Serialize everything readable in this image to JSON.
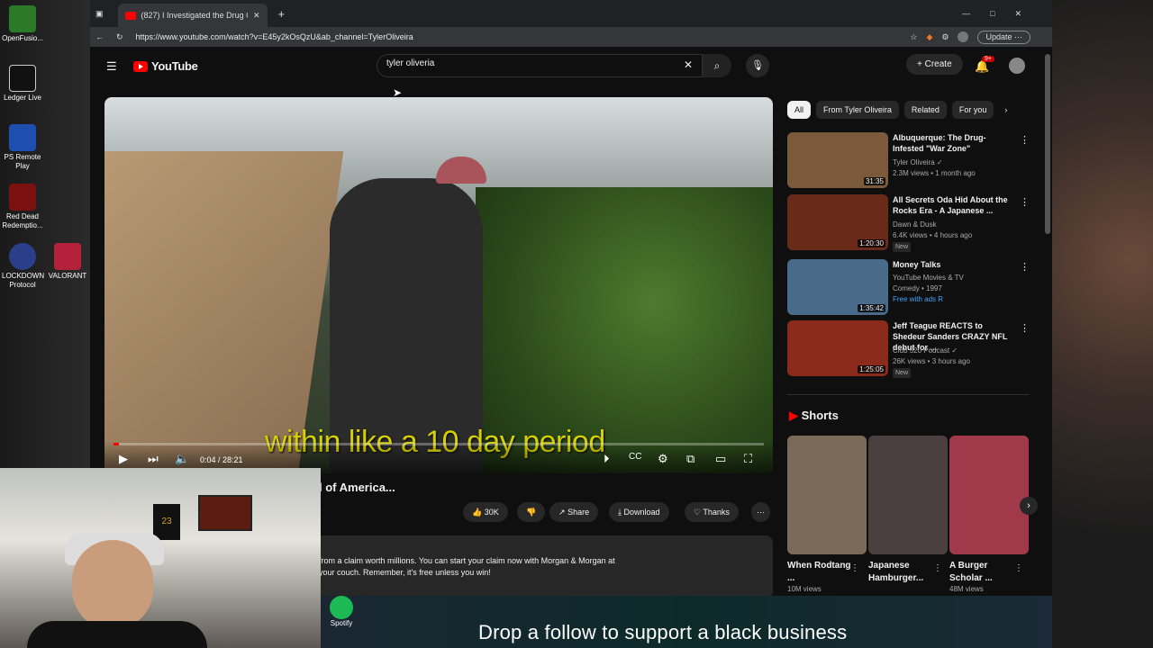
{
  "desktop": {
    "icons": [
      {
        "label": "OpenFusio...",
        "color": "#2a7a2a"
      },
      {
        "label": "Ledger Live",
        "color": "#111"
      },
      {
        "label": "PS Remote Play",
        "color": "#1d4fb0"
      },
      {
        "label": "Red Dead Redemptio...",
        "color": "#7a1010"
      },
      {
        "label": "LOCKDOWN Protocol",
        "color": "#2a3e8a"
      },
      {
        "label": "VALORANT",
        "color": "#b3223a"
      }
    ]
  },
  "browser": {
    "tab_title": "(827) I Investigated the Drug Ov...",
    "url": "https://www.youtube.com/watch?v=E45y2kOsQzU&ab_channel=TylerOliveira",
    "update_label": "Update"
  },
  "youtube": {
    "logo": "YouTube",
    "search_value": "tyler oliveria",
    "create_label": "Create",
    "notif_count": "9+",
    "video": {
      "caption": "within like a 10 day period",
      "time": "0:04 / 28:21",
      "progress": 0.002,
      "title": "l of America...",
      "likes": "30K",
      "share": "Share",
      "download": "Download",
      "thanks": "Thanks"
    },
    "description": {
      "line1": "from a claim worth millions. You can start your claim now with Morgan & Morgan at",
      "line2": "your couch. Remember, it's free unless you win!"
    },
    "chips": [
      "All",
      "From Tyler Oliveira",
      "Related",
      "For you"
    ],
    "recs": [
      {
        "title": "Albuquerque: The Drug-Infested \"War Zone\"",
        "channel": "Tyler Oliveira ✓",
        "meta": "2.3M views • 1 month ago",
        "duration": "31:35",
        "badge": "",
        "thumb": "#7a5a3a"
      },
      {
        "title": "All Secrets Oda Hid About the Rocks Era - A Japanese ...",
        "channel": "Dawn & Dusk",
        "meta": "6.4K views • 4 hours ago",
        "duration": "1:20:30",
        "badge": "New",
        "thumb": "#6a2a1a"
      },
      {
        "title": "Money Talks",
        "channel": "YouTube Movies & TV",
        "meta": "Comedy • 1997",
        "duration": "1:35:42",
        "badge": "Free with ads  R",
        "thumb": "#4a6a8a"
      },
      {
        "title": "Jeff Teague REACTS to Shedeur Sanders CRAZY NFL debut for ...",
        "channel": "Club 520 Podcast ✓",
        "meta": "26K views • 3 hours ago",
        "duration": "1:25:05",
        "badge": "New",
        "thumb": "#8a2a1a"
      }
    ],
    "shorts_heading": "Shorts",
    "shorts": [
      {
        "title": "When Rodtang ...",
        "views": "10M views",
        "color": "#7a6a5a"
      },
      {
        "title": "Japanese Hamburger...",
        "views": "",
        "color": "#4a4040"
      },
      {
        "title": "A Burger Scholar ...",
        "views": "48M views",
        "color": "#a03a4a"
      }
    ]
  },
  "stream_overlay": {
    "spotify_label": "Spotify",
    "follow_text": "Drop a follow to support a black business"
  }
}
